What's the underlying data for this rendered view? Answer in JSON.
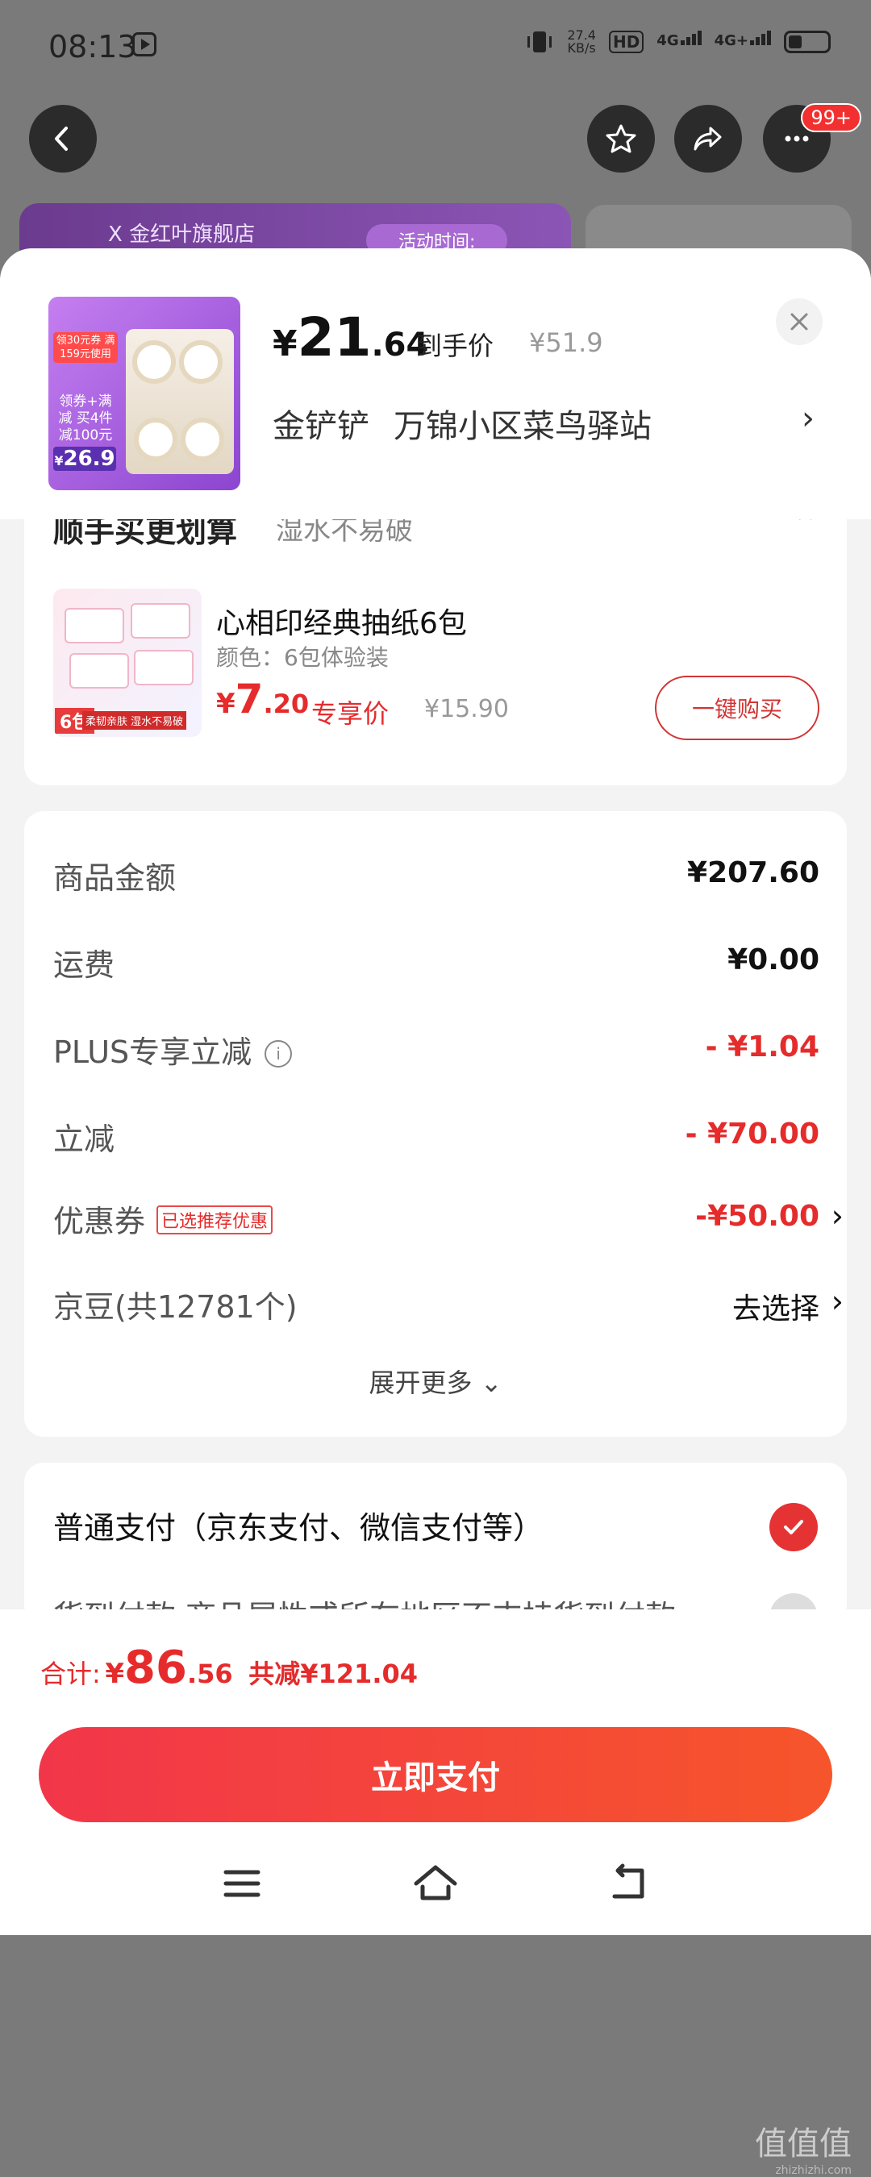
{
  "status_bar": {
    "time": "08:13",
    "net_speed_value": "27.4",
    "net_speed_unit": "KB/s",
    "hd": "HD",
    "signal1": "4G",
    "signal2": "4G+"
  },
  "top_nav": {
    "badge": "99+"
  },
  "background": {
    "banner_text": "X 金红叶旗舰店",
    "banner_activity": "活动时间:"
  },
  "sheet_header": {
    "price_currency": "¥",
    "price_int": "21",
    "price_dec": ".64",
    "price_tag": "到手价",
    "original_price": "¥51.9",
    "address_name": "金铲铲",
    "address_place": "万锦小区菜鸟驿站",
    "product_image": {
      "coupon": "领30元券 满159元使用",
      "promo": "领券+满减 买4件 减100元",
      "price_prefix": "¥",
      "price": "26.9"
    }
  },
  "recommendation": {
    "title": "顺手买更划算",
    "subtitle": "湿水不易破",
    "product_name": "心相印经典抽纸6包",
    "spec": "颜色：6包体验装",
    "price_currency": "¥",
    "price_int": "7",
    "price_dec": ".20",
    "price_tag": "专享价",
    "original_price": "¥15.90",
    "buy_button": "一键购买",
    "image_count": "6包",
    "image_tag": "柔韧亲肤 湿水不易破"
  },
  "summary": {
    "rows": [
      {
        "label": "商品金额",
        "value": "¥207.60"
      },
      {
        "label": "运费",
        "value": "¥0.00"
      },
      {
        "label": "PLUS专享立减",
        "value": "- ¥1.04"
      },
      {
        "label": "立减",
        "value": "- ¥70.00"
      },
      {
        "label": "优惠券",
        "badge": "已选推荐优惠",
        "value": "-¥50.00"
      },
      {
        "label": "京豆(共12781个)",
        "value": "去选择"
      }
    ],
    "expand": "展开更多"
  },
  "payment": {
    "option1": "普通支付（京东支付、微信支付等）",
    "option2": "货到付款 商品属性或所在地区不支持货到付款"
  },
  "footer": {
    "total_label": "合计:",
    "total_currency": "¥",
    "total_int": "86",
    "total_dec": ".56",
    "total_saved": "共减¥121.04",
    "pay_button": "立即支付",
    "watermark": "值值值",
    "watermark_url": "zhizhizhi.com"
  },
  "colors": {
    "accent_red": "#e52b2b",
    "pay_gradient_start": "#f2364a",
    "pay_gradient_end": "#f6552b"
  },
  "icons": [
    "back-arrow-icon",
    "star-icon",
    "share-icon",
    "more-icon",
    "close-icon",
    "chevron-right-icon",
    "info-icon",
    "check-icon",
    "menu-icon",
    "home-icon",
    "back-icon"
  ]
}
